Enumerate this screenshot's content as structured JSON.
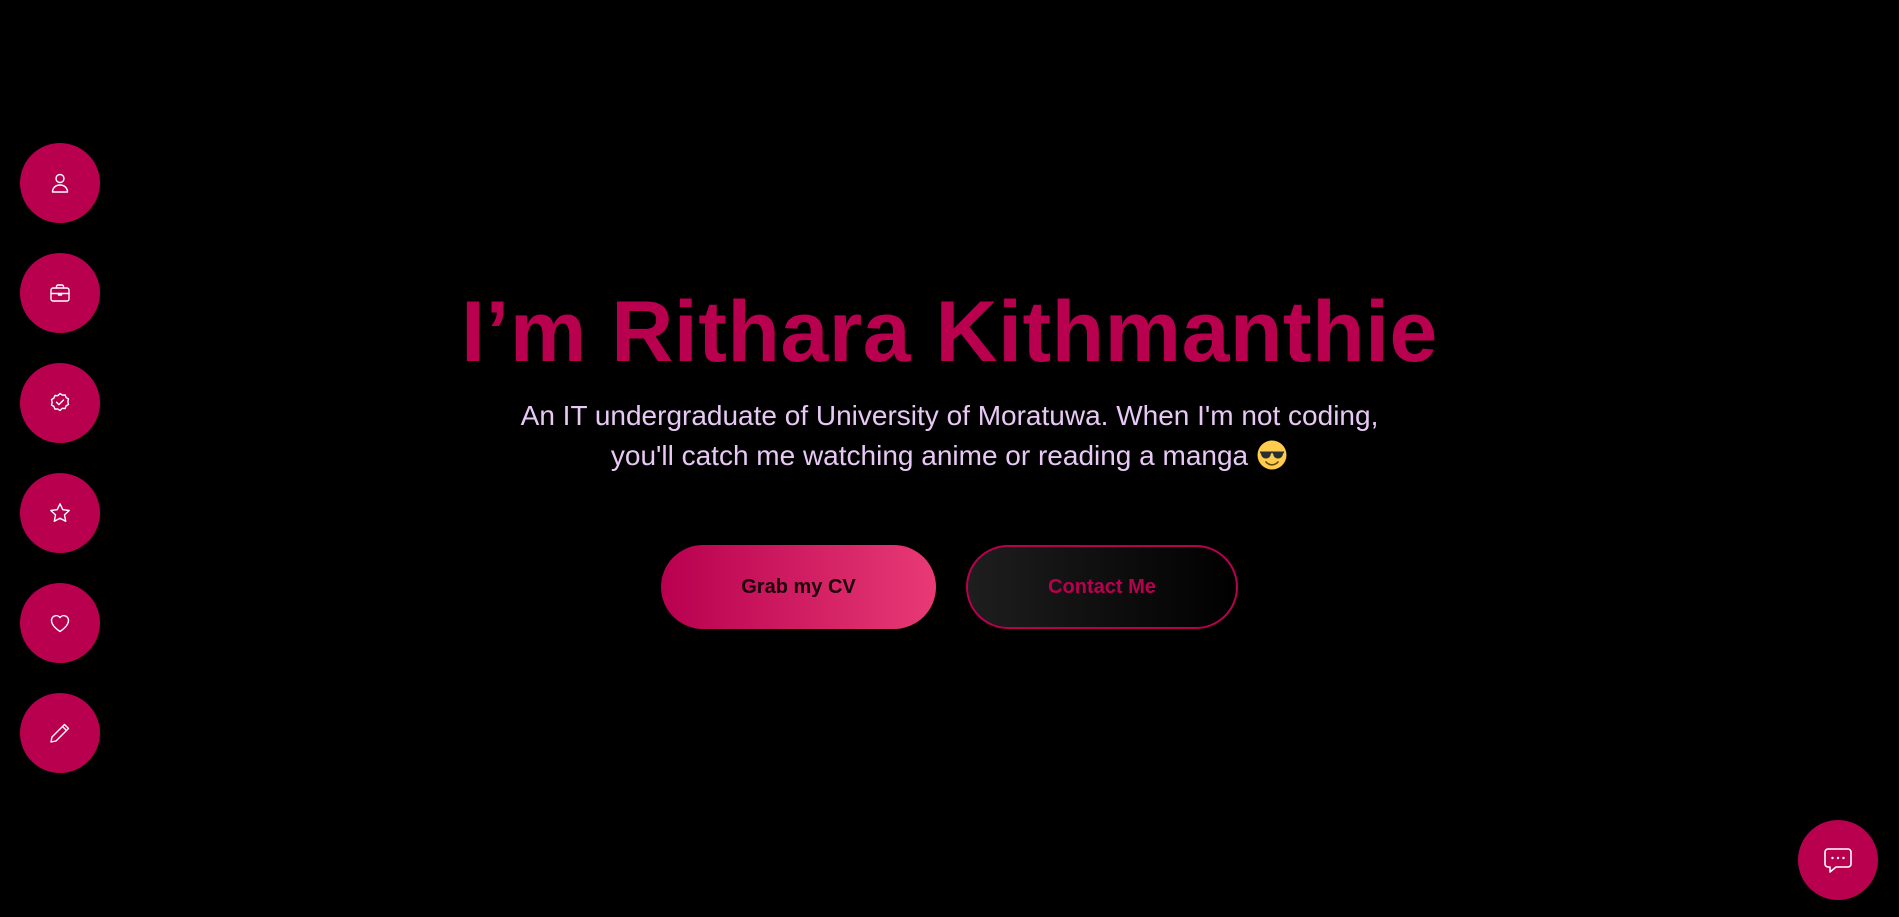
{
  "colors": {
    "background": "#000000",
    "accent": "#b8004f",
    "accent_light": "#e83a75",
    "subtitle_text": "#e8c8f5"
  },
  "side_nav": {
    "items": [
      {
        "icon": "user-icon"
      },
      {
        "icon": "briefcase-icon"
      },
      {
        "icon": "badge-check-icon"
      },
      {
        "icon": "star-icon"
      },
      {
        "icon": "heart-icon"
      },
      {
        "icon": "pencil-icon"
      }
    ]
  },
  "hero": {
    "title": "I’m Rithara Kithmanthie",
    "subtitle_line1": "An IT undergraduate of University of Moratuwa. When I'm not coding,",
    "subtitle_line2": "you'll catch me watching anime or reading a manga",
    "emoji_icon": "smiling-face-with-sunglasses-icon"
  },
  "actions": {
    "cv_label": "Grab my CV",
    "contact_label": "Contact Me"
  },
  "chat": {
    "icon": "chat-bubble-icon"
  }
}
